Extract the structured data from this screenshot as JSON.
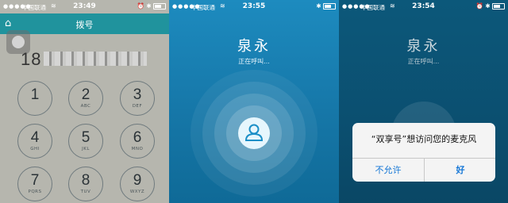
{
  "panel1": {
    "status": {
      "signal": "●●●●●",
      "carrier": "中国联通",
      "time": "23:49"
    },
    "title": "拨号",
    "number_visible": "18",
    "keys": [
      {
        "digit": "1",
        "letters": ""
      },
      {
        "digit": "2",
        "letters": "ABC"
      },
      {
        "digit": "3",
        "letters": "DEF"
      },
      {
        "digit": "4",
        "letters": "GHI"
      },
      {
        "digit": "5",
        "letters": "JKL"
      },
      {
        "digit": "6",
        "letters": "MNO"
      },
      {
        "digit": "7",
        "letters": "PQRS"
      },
      {
        "digit": "8",
        "letters": "TUV"
      },
      {
        "digit": "9",
        "letters": "WXYZ"
      }
    ]
  },
  "panel2": {
    "status": {
      "signal": "●●●●●",
      "carrier": "中国联通",
      "time": "23:55"
    },
    "contact_name": "泉永",
    "call_status": "正在呼叫..."
  },
  "panel3": {
    "status": {
      "signal": "●●●●●",
      "carrier": "中国联通",
      "time": "23:54"
    },
    "contact_name": "泉永",
    "call_status": "正在呼叫...",
    "alert": {
      "title": "“双享号”想访问您的麦克风",
      "deny_label": "不允许",
      "allow_label": "好"
    }
  },
  "colors": {
    "accent": "#20939d",
    "call_bg": "#1a84b7",
    "alert_button": "#1677d6"
  }
}
